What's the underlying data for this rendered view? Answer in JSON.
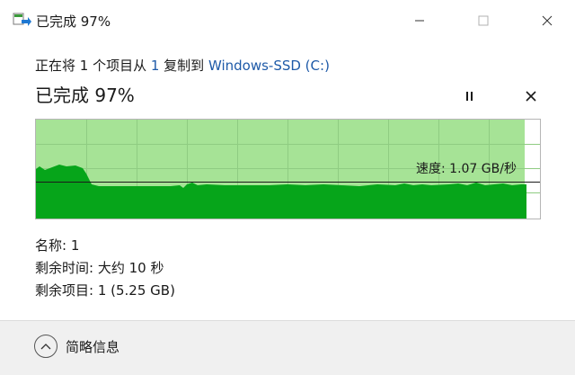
{
  "window": {
    "title": "已完成 97%",
    "icons": {
      "app": "file-copy-icon",
      "minimize": "minimize-icon",
      "maximize": "maximize-icon",
      "close": "close-icon"
    }
  },
  "copy": {
    "desc_prefix": "正在将 1 个项目从 ",
    "source": "1",
    "desc_middle": " 复制到 ",
    "destination": "Windows-SSD (C:)",
    "status": "已完成 97%",
    "progress_fraction": 0.97
  },
  "controls": {
    "pause_icon": "pause-icon",
    "cancel_icon": "cancel-icon"
  },
  "graph": {
    "speed_label": "速度: 1.07 GB/秒",
    "colors": {
      "done": "#06a51a",
      "progress_bg": "#a6e396",
      "grid": "#8fcc82"
    }
  },
  "details": {
    "name": "名称: 1",
    "time_remaining": "剩余时间: 大约 10 秒",
    "items_remaining": "剩余项目: 1 (5.25 GB)"
  },
  "footer": {
    "fewer_details_label": "简略信息",
    "fewer_details_icon": "chevron-up-icon"
  }
}
